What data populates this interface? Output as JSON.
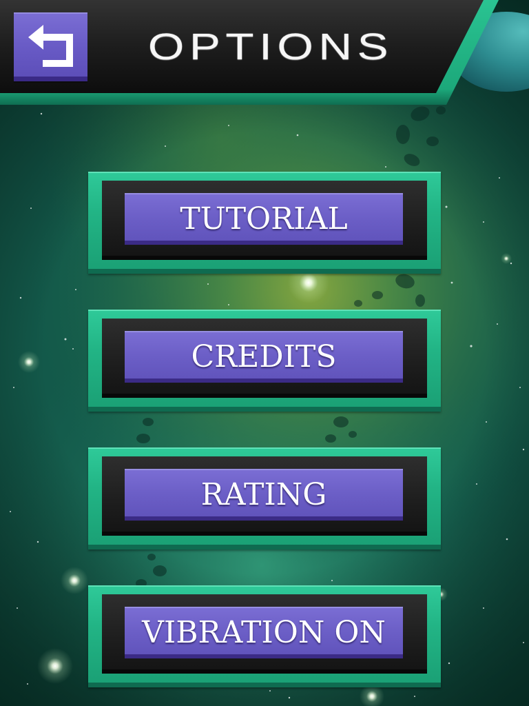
{
  "header": {
    "title": "OPTIONS",
    "back_button": {
      "icon": "back-arrow-icon"
    }
  },
  "menu": {
    "buttons": [
      {
        "label": "TUTORIAL"
      },
      {
        "label": "CREDITS"
      },
      {
        "label": "RATING"
      },
      {
        "label": "VIBRATION ON"
      }
    ]
  },
  "colors": {
    "accent_green": "#22b485",
    "button_purple": "#6b5ec6",
    "header_dark": "#1d1d1d",
    "planet_teal": "#2a8a8e",
    "label_text": "#ffffff"
  }
}
